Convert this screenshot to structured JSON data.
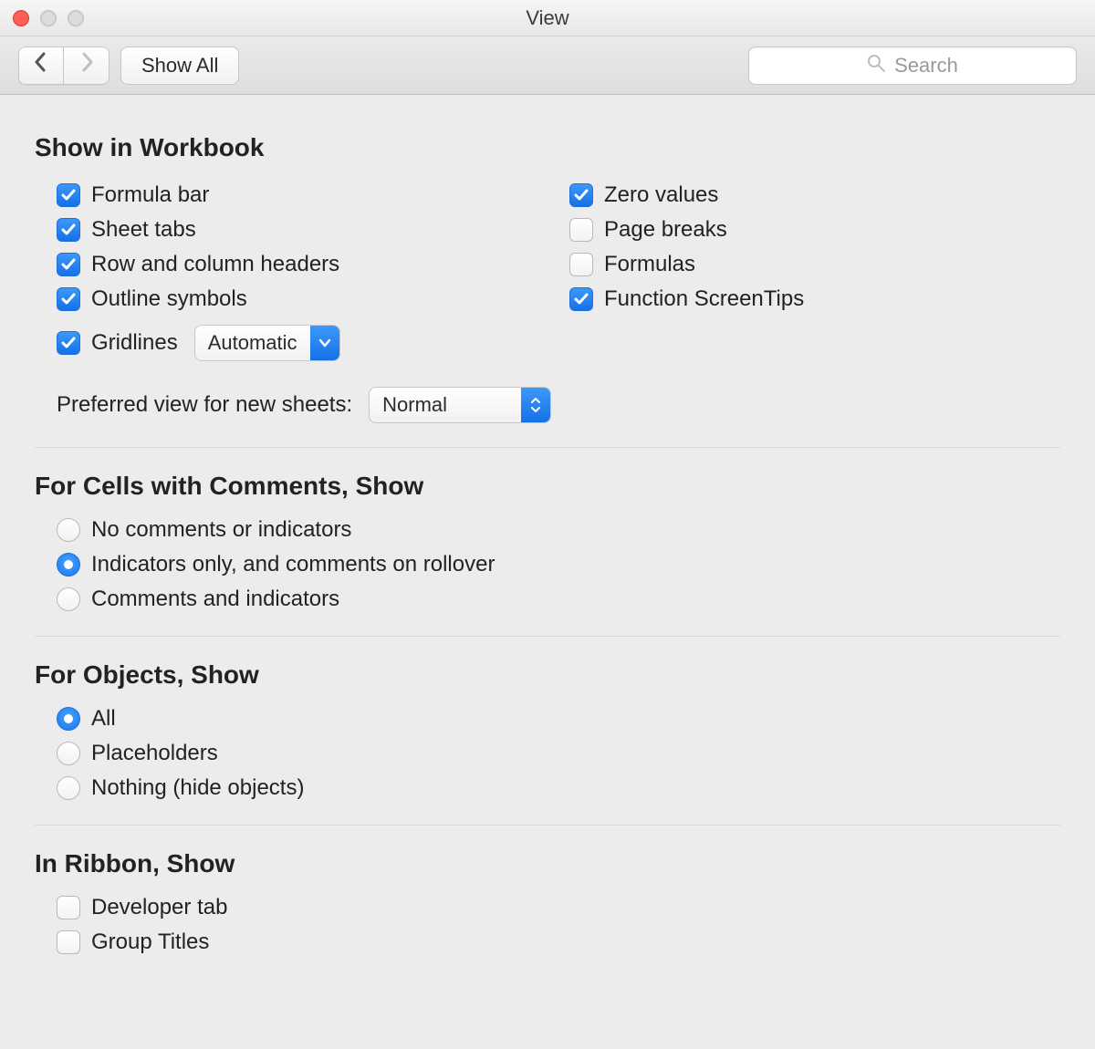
{
  "window": {
    "title": "View"
  },
  "toolbar": {
    "show_all": "Show All",
    "search_placeholder": "Search"
  },
  "sections": {
    "show_in_workbook": {
      "title": "Show in Workbook",
      "items": {
        "formula_bar": {
          "label": "Formula bar",
          "checked": true
        },
        "sheet_tabs": {
          "label": "Sheet tabs",
          "checked": true
        },
        "row_col_headers": {
          "label": "Row and column headers",
          "checked": true
        },
        "outline_symbols": {
          "label": "Outline symbols",
          "checked": true
        },
        "gridlines": {
          "label": "Gridlines",
          "checked": true
        },
        "zero_values": {
          "label": "Zero values",
          "checked": true
        },
        "page_breaks": {
          "label": "Page breaks",
          "checked": false
        },
        "formulas": {
          "label": "Formulas",
          "checked": false
        },
        "function_screentips": {
          "label": "Function ScreenTips",
          "checked": true
        }
      },
      "gridlines_color": "Automatic",
      "preferred_view_label": "Preferred view for new sheets:",
      "preferred_view_value": "Normal"
    },
    "cells_comments": {
      "title": "For Cells with Comments, Show",
      "options": {
        "none": {
          "label": "No comments or indicators",
          "checked": false
        },
        "indicators": {
          "label": "Indicators only, and comments on rollover",
          "checked": true
        },
        "both": {
          "label": "Comments and indicators",
          "checked": false
        }
      }
    },
    "objects": {
      "title": "For Objects, Show",
      "options": {
        "all": {
          "label": "All",
          "checked": true
        },
        "placeholders": {
          "label": "Placeholders",
          "checked": false
        },
        "nothing": {
          "label": "Nothing (hide objects)",
          "checked": false
        }
      }
    },
    "ribbon": {
      "title": "In Ribbon, Show",
      "items": {
        "developer_tab": {
          "label": "Developer tab",
          "checked": false
        },
        "group_titles": {
          "label": "Group Titles",
          "checked": false
        }
      }
    }
  }
}
